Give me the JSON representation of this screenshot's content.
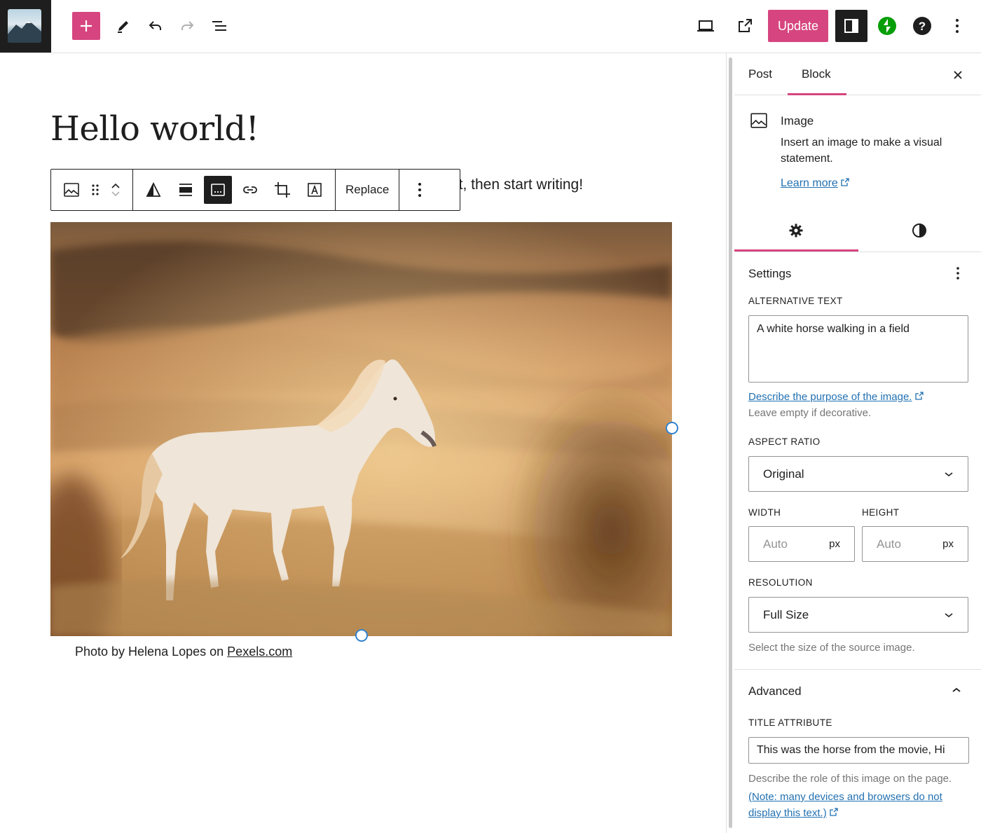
{
  "topbar": {
    "update_label": "Update"
  },
  "editor": {
    "post_title": "Hello world!",
    "paragraph_visible_text": "it, then start writing!",
    "toolbar": {
      "replace_label": "Replace"
    },
    "caption": {
      "prefix": "Photo by Helena Lopes on ",
      "link_text": "Pexels.com"
    },
    "image_alt": "A white horse walking in a field"
  },
  "sidebar": {
    "tabs": [
      "Post",
      "Block"
    ],
    "active_tab": "Block",
    "block": {
      "title": "Image",
      "description": "Insert an image to make a visual statement.",
      "learn_more": "Learn more"
    },
    "settings": {
      "title": "Settings",
      "alt_label": "ALTERNATIVE TEXT",
      "alt_value": "A white horse walking in a field",
      "alt_help_link": "Describe the purpose of the image.",
      "alt_help_text": "Leave empty if decorative.",
      "aspect_label": "ASPECT RATIO",
      "aspect_value": "Original",
      "width_label": "WIDTH",
      "height_label": "HEIGHT",
      "width_placeholder": "Auto",
      "height_placeholder": "Auto",
      "unit": "px",
      "resolution_label": "RESOLUTION",
      "resolution_value": "Full Size",
      "resolution_help": "Select the size of the source image."
    },
    "advanced": {
      "title": "Advanced",
      "title_attr_label": "TITLE ATTRIBUTE",
      "title_attr_value": "This was the horse from the movie, Hi",
      "help_text": "Describe the role of this image on the page.",
      "help_link": "(Note: many devices and browsers do not display this text.)"
    }
  },
  "colors": {
    "accent": "#d6457f",
    "link": "#2271b1",
    "handle": "#3182ce",
    "dark": "#1e1e1e",
    "jetpack": "#069e08"
  }
}
